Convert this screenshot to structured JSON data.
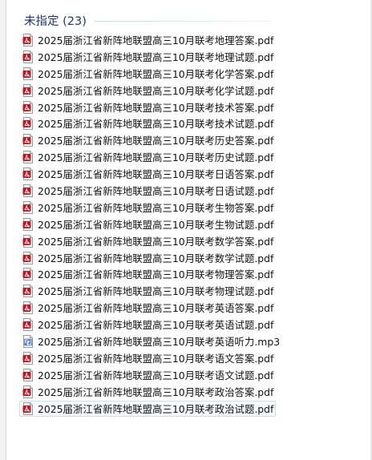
{
  "group": {
    "title": "未指定 (23)"
  },
  "files": [
    {
      "name": "2025届浙江省新阵地联盟高三10月联考地理答案.pdf",
      "icon": "pdf-file-icon"
    },
    {
      "name": "2025届浙江省新阵地联盟高三10月联考地理试题.pdf",
      "icon": "pdf-file-icon"
    },
    {
      "name": "2025届浙江省新阵地联盟高三10月联考化学答案.pdf",
      "icon": "pdf-file-icon"
    },
    {
      "name": "2025届浙江省新阵地联盟高三10月联考化学试题.pdf",
      "icon": "pdf-file-icon"
    },
    {
      "name": "2025届浙江省新阵地联盟高三10月联考技术答案.pdf",
      "icon": "pdf-file-icon"
    },
    {
      "name": "2025届浙江省新阵地联盟高三10月联考技术试题.pdf",
      "icon": "pdf-file-icon"
    },
    {
      "name": "2025届浙江省新阵地联盟高三10月联考历史答案.pdf",
      "icon": "pdf-file-icon"
    },
    {
      "name": "2025届浙江省新阵地联盟高三10月联考历史试题.pdf",
      "icon": "pdf-file-icon"
    },
    {
      "name": "2025届浙江省新阵地联盟高三10月联考日语答案.pdf",
      "icon": "pdf-file-icon"
    },
    {
      "name": "2025届浙江省新阵地联盟高三10月联考日语试题.pdf",
      "icon": "pdf-file-icon"
    },
    {
      "name": "2025届浙江省新阵地联盟高三10月联考生物答案.pdf",
      "icon": "pdf-file-icon"
    },
    {
      "name": "2025届浙江省新阵地联盟高三10月联考生物试题.pdf",
      "icon": "pdf-file-icon"
    },
    {
      "name": "2025届浙江省新阵地联盟高三10月联考数学答案.pdf",
      "icon": "pdf-file-icon"
    },
    {
      "name": "2025届浙江省新阵地联盟高三10月联考数学试题.pdf",
      "icon": "pdf-file-icon"
    },
    {
      "name": "2025届浙江省新阵地联盟高三10月联考物理答案.pdf",
      "icon": "pdf-file-icon"
    },
    {
      "name": "2025届浙江省新阵地联盟高三10月联考物理试题.pdf",
      "icon": "pdf-file-icon"
    },
    {
      "name": "2025届浙江省新阵地联盟高三10月联考英语答案.pdf",
      "icon": "pdf-file-icon"
    },
    {
      "name": "2025届浙江省新阵地联盟高三10月联考英语试题.pdf",
      "icon": "pdf-file-icon"
    },
    {
      "name": "2025届浙江省新阵地联盟高三10月联考英语听力.mp3",
      "icon": "audio-file-icon"
    },
    {
      "name": "2025届浙江省新阵地联盟高三10月联考语文答案.pdf",
      "icon": "pdf-file-icon"
    },
    {
      "name": "2025届浙江省新阵地联盟高三10月联考语文试题.pdf",
      "icon": "pdf-file-icon"
    },
    {
      "name": "2025届浙江省新阵地联盟高三10月联考政治答案.pdf",
      "icon": "pdf-file-icon"
    },
    {
      "name": "2025届浙江省新阵地联盟高三10月联考政治试题.pdf",
      "icon": "pdf-file-icon",
      "selected": true
    }
  ],
  "colors": {
    "group_title": "#1e3287",
    "pdf_red": "#c8141e",
    "audio_blue": "#3a6fc4"
  }
}
